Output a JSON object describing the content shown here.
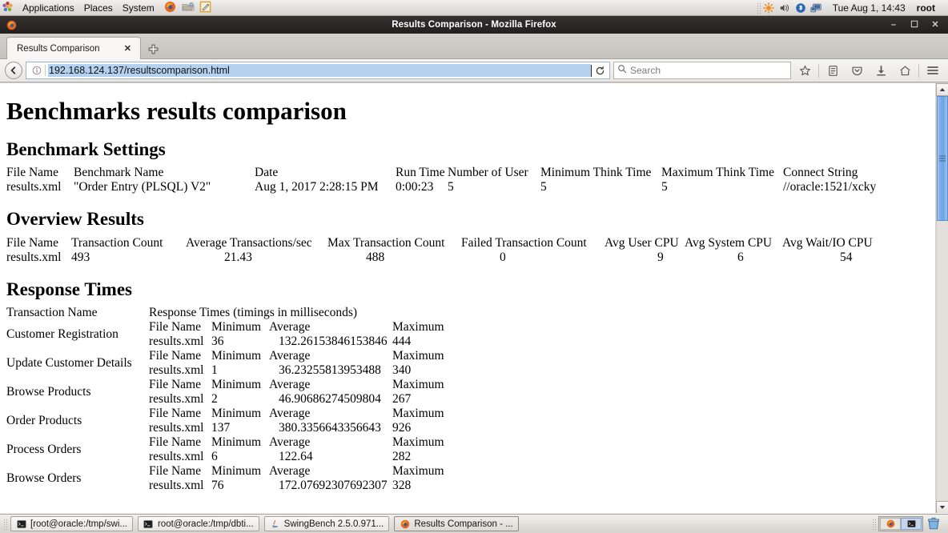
{
  "desktop": {
    "panel": {
      "menus": [
        "Applications",
        "Places",
        "System"
      ],
      "launchers": [
        "firefox-icon",
        "file-manager-icon",
        "text-editor-icon"
      ],
      "tray": [
        "brightness-icon",
        "volume-icon",
        "bluetooth-icon",
        "network-icon"
      ],
      "clock": "Tue Aug  1, 14:43",
      "user": "root"
    },
    "taskbar": {
      "tasks": [
        {
          "label": "[root@oracle:/tmp/swi...",
          "icon": "terminal-icon",
          "active": false
        },
        {
          "label": "root@oracle:/tmp/dbti...",
          "icon": "terminal-icon",
          "active": false
        },
        {
          "label": "SwingBench 2.5.0.971...",
          "icon": "java-icon",
          "active": false
        },
        {
          "label": "Results Comparison - ...",
          "icon": "firefox-icon",
          "active": true
        }
      ],
      "workspaces": [
        "firefox-icon",
        "terminal-icon"
      ],
      "selected_workspace": 1,
      "trash": "trash-icon"
    }
  },
  "browser": {
    "window_title": "Results Comparison - Mozilla Firefox",
    "window_buttons": [
      "minimize",
      "maximize",
      "close"
    ],
    "tabs": [
      {
        "label": "Results Comparison",
        "close": "✕",
        "active": true
      }
    ],
    "new_tab_label": "+",
    "nav": {
      "back_icon": "back-arrow-icon",
      "identity_icon": "page-info-icon",
      "url": "192.168.124.137/resultscomparison.html",
      "reload_icon": "reload-icon",
      "search_placeholder": "Search",
      "search_icon": "search-icon",
      "toolbar_icons": [
        "bookmark-star-icon",
        "reader-list-icon",
        "pocket-icon",
        "downloads-icon",
        "home-icon",
        "menu-hamburger-icon"
      ]
    }
  },
  "page": {
    "title": "Benchmarks results comparison",
    "sections": {
      "settings": {
        "heading": "Benchmark Settings",
        "headers": [
          "File Name",
          "Benchmark Name",
          "Date",
          "Run Time",
          "Number of User",
          "Minimum Think Time",
          "Maximum Think Time",
          "Connect String"
        ],
        "rows": [
          [
            "results.xml",
            "\"Order Entry (PLSQL) V2\"",
            "Aug 1, 2017 2:28:15 PM",
            "0:00:23",
            "5",
            "5",
            "5",
            "//oracle:1521/xcky"
          ]
        ]
      },
      "overview": {
        "heading": "Overview Results",
        "headers": [
          "File Name",
          "Transaction Count",
          "Average Transactions/sec",
          "Max Transaction Count",
          "Failed Transaction Count",
          "Avg User CPU",
          "Avg System CPU",
          "Avg Wait/IO CPU"
        ],
        "rows": [
          [
            "results.xml",
            "493",
            "21.43",
            "488",
            "0",
            "9",
            "6",
            "54"
          ]
        ]
      },
      "response": {
        "heading": "Response Times",
        "col_left_header": "Transaction Name",
        "col_right_header": "Response Times (timings in milliseconds)",
        "inner_headers": [
          "File Name",
          "Minimum",
          "Average",
          "Maximum"
        ],
        "rows": [
          {
            "name": "Customer Registration",
            "file": "results.xml",
            "min": "36",
            "avg": "132.26153846153846",
            "max": "444"
          },
          {
            "name": "Update Customer Details",
            "file": "results.xml",
            "min": "1",
            "avg": "36.23255813953488",
            "max": "340"
          },
          {
            "name": "Browse Products",
            "file": "results.xml",
            "min": "2",
            "avg": "46.90686274509804",
            "max": "267"
          },
          {
            "name": "Order Products",
            "file": "results.xml",
            "min": "137",
            "avg": "380.3356643356643",
            "max": "926"
          },
          {
            "name": "Process Orders",
            "file": "results.xml",
            "min": "6",
            "avg": "122.64",
            "max": "282"
          },
          {
            "name": "Browse Orders",
            "file": "results.xml",
            "min": "76",
            "avg": "172.07692307692307",
            "max": "328"
          }
        ]
      }
    }
  },
  "colors": {
    "url_selection": "#b4d2f0",
    "scrollbar_thumb": "#6ba3e8",
    "titlebar": "#241f1e",
    "panel": "#e3e1de"
  }
}
